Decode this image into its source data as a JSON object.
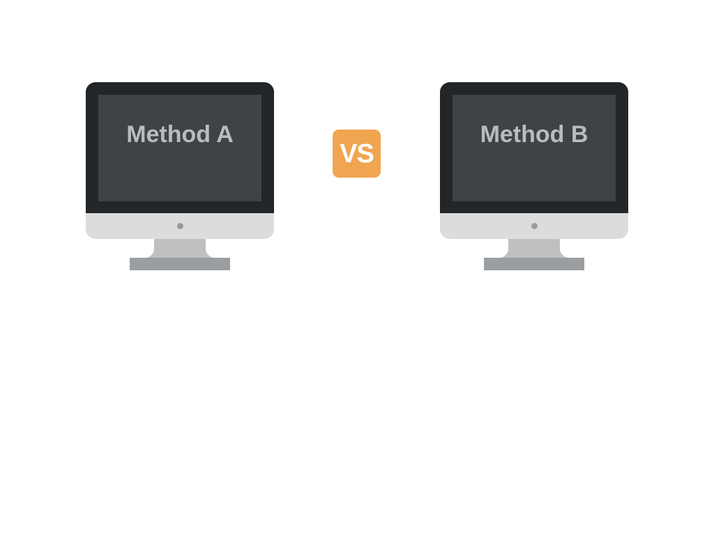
{
  "left_monitor": {
    "label": "Method A",
    "icon": "desktop-monitor-icon"
  },
  "right_monitor": {
    "label": "Method B",
    "icon": "desktop-monitor-icon"
  },
  "versus_badge": {
    "label": "VS",
    "color": "#f0a550"
  },
  "colors": {
    "bezel": "#222629",
    "screen": "#3e4347",
    "screen_text": "#b9bcbe",
    "chin": "#dcdcdc",
    "neck": "#c0c0c0",
    "foot": "#9b9ea1"
  }
}
